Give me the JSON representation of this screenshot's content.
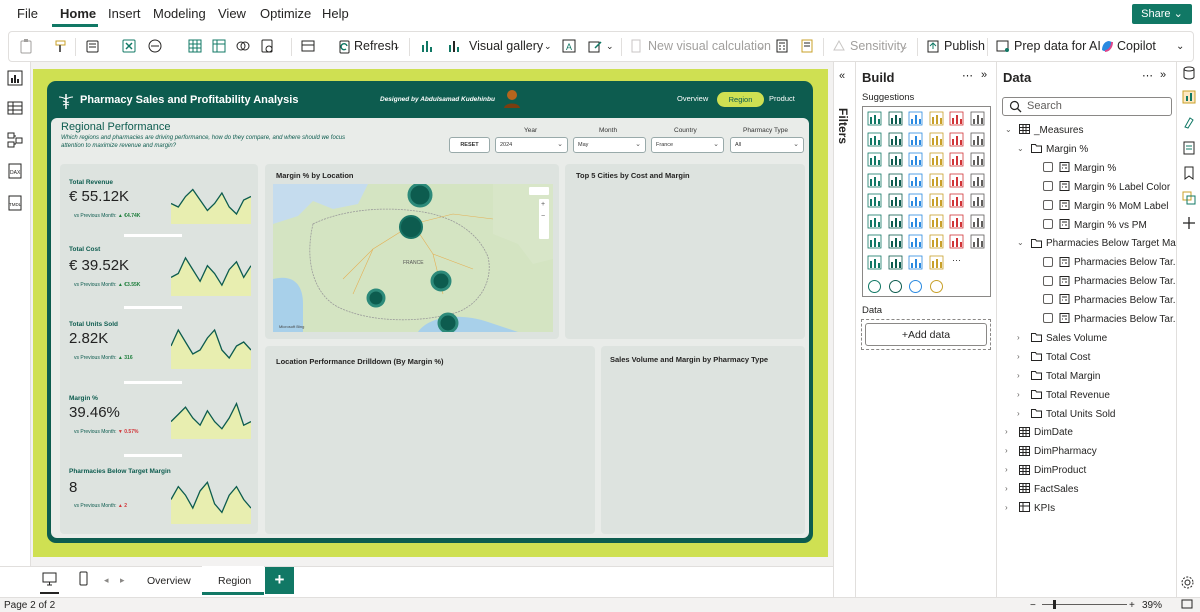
{
  "menu": {
    "items": [
      "File",
      "Home",
      "Insert",
      "Modeling",
      "View",
      "Optimize",
      "Help"
    ],
    "share_label": "Share"
  },
  "ribbon": {
    "refresh": "Refresh",
    "visual_gallery": "Visual gallery",
    "new_visual_calculation": "New visual calculation",
    "sensitivity": "Sensitivity",
    "publish": "Publish",
    "prep_data_ai": "Prep data for AI",
    "copilot": "Copilot"
  },
  "report": {
    "title": "Pharmacy Sales and Profitability Analysis",
    "designed_by": "Designed by Abdulsamad Kudehinbu",
    "nav": [
      "Overview",
      "Region",
      "Product"
    ],
    "section_title": "Regional Performance",
    "section_subtitle": "Which regions and pharmacies are driving performance, how do they compare, and where should we focus attention to maximize revenue and margin?",
    "reset": "RESET",
    "filters": [
      {
        "label": "Year",
        "value": "2024"
      },
      {
        "label": "Month",
        "value": "May"
      },
      {
        "label": "Country",
        "value": "France"
      },
      {
        "label": "Pharmacy Type",
        "value": "All"
      }
    ],
    "kpis": [
      {
        "label": "Total Revenue",
        "value": "€ 55.12K",
        "comparison": "vs Previous Month:",
        "delta": "▲ €4.74K",
        "trend": [
          0.5,
          0.4,
          0.7,
          0.9,
          0.6,
          0.3,
          0.5,
          0.8,
          0.4,
          0.2,
          0.6,
          0.7
        ]
      },
      {
        "label": "Total Cost",
        "value": "€ 39.52K",
        "comparison": "vs Previous Month:",
        "delta": "▲ €3.55K",
        "trend": [
          0.4,
          0.5,
          0.9,
          0.6,
          0.3,
          0.7,
          0.5,
          0.2,
          0.6,
          0.8,
          0.4,
          0.7
        ]
      },
      {
        "label": "Total Units Sold",
        "value": "2.82K",
        "comparison": "vs Previous Month:",
        "delta": "▲ 316",
        "trend": [
          0.5,
          0.9,
          0.6,
          0.3,
          0.4,
          0.7,
          0.9,
          0.4,
          0.2,
          0.5,
          0.6,
          0.4
        ]
      },
      {
        "label": "Margin %",
        "value": "39.46%",
        "comparison": "vs Previous Month:",
        "delta": "▼ 0.57%",
        "trend": [
          0.4,
          0.6,
          0.8,
          0.5,
          0.3,
          0.7,
          0.4,
          0.2,
          0.5,
          0.9,
          0.3,
          0.4
        ]
      },
      {
        "label": "Pharmacies Below Target Margin",
        "value": "8",
        "comparison": "vs Previous Month:",
        "delta": "▲ 2",
        "trend": [
          0.5,
          0.8,
          0.6,
          0.3,
          0.7,
          0.9,
          0.4,
          0.2,
          0.6,
          0.8,
          0.5,
          0.3
        ]
      }
    ],
    "visual_titles": {
      "map": "Margin % by Location",
      "top5": "Top 5 Cities by Cost and Margin",
      "drilldown": "Location Performance Drilldown (By Margin %)",
      "sales_volume": "Sales Volume and Margin by Pharmacy Type"
    },
    "map_labels": {
      "country": "FRANCE",
      "attribution": "Microsoft Bing"
    }
  },
  "filters_pane": {
    "label": "Filters"
  },
  "build": {
    "title": "Build",
    "suggestions": "Suggestions",
    "data": "Data",
    "add_data": "+Add data"
  },
  "data_pane": {
    "title": "Data",
    "search_placeholder": "Search",
    "tree": [
      {
        "level": 0,
        "type": "table",
        "expanded": true,
        "label": "_Measures"
      },
      {
        "level": 1,
        "type": "folder",
        "expanded": true,
        "label": "Margin %"
      },
      {
        "level": 2,
        "type": "measure",
        "label": "Margin %"
      },
      {
        "level": 2,
        "type": "measure",
        "label": "Margin % Label Color"
      },
      {
        "level": 2,
        "type": "measure",
        "label": "Margin % MoM Label"
      },
      {
        "level": 2,
        "type": "measure",
        "label": "Margin % vs PM"
      },
      {
        "level": 1,
        "type": "folder",
        "expanded": true,
        "label": "Pharmacies Below Target Ma..."
      },
      {
        "level": 2,
        "type": "measure",
        "label": "Pharmacies Below Tar..."
      },
      {
        "level": 2,
        "type": "measure",
        "label": "Pharmacies Below Tar..."
      },
      {
        "level": 2,
        "type": "measure",
        "label": "Pharmacies Below Tar..."
      },
      {
        "level": 2,
        "type": "measure",
        "label": "Pharmacies Below Tar..."
      },
      {
        "level": 1,
        "type": "folder",
        "expanded": false,
        "label": "Sales Volume"
      },
      {
        "level": 1,
        "type": "folder",
        "expanded": false,
        "label": "Total Cost"
      },
      {
        "level": 1,
        "type": "folder",
        "expanded": false,
        "label": "Total Margin"
      },
      {
        "level": 1,
        "type": "folder",
        "expanded": false,
        "label": "Total Revenue"
      },
      {
        "level": 1,
        "type": "folder",
        "expanded": false,
        "label": "Total Units Sold"
      },
      {
        "level": 0,
        "type": "table",
        "expanded": false,
        "label": "DimDate"
      },
      {
        "level": 0,
        "type": "table",
        "expanded": false,
        "label": "DimPharmacy"
      },
      {
        "level": 0,
        "type": "table",
        "expanded": false,
        "label": "DimProduct"
      },
      {
        "level": 0,
        "type": "table",
        "expanded": false,
        "label": "FactSales"
      },
      {
        "level": 0,
        "type": "kpi",
        "expanded": false,
        "label": "KPIs"
      }
    ]
  },
  "pages": {
    "tabs": [
      "Overview",
      "Region"
    ],
    "active": "Region"
  },
  "status": {
    "page": "Page 2 of 2",
    "zoom": "39%"
  },
  "colors": {
    "accent": "#117865",
    "dashboard": "#0d5c4f",
    "lime": "#cfe052"
  }
}
